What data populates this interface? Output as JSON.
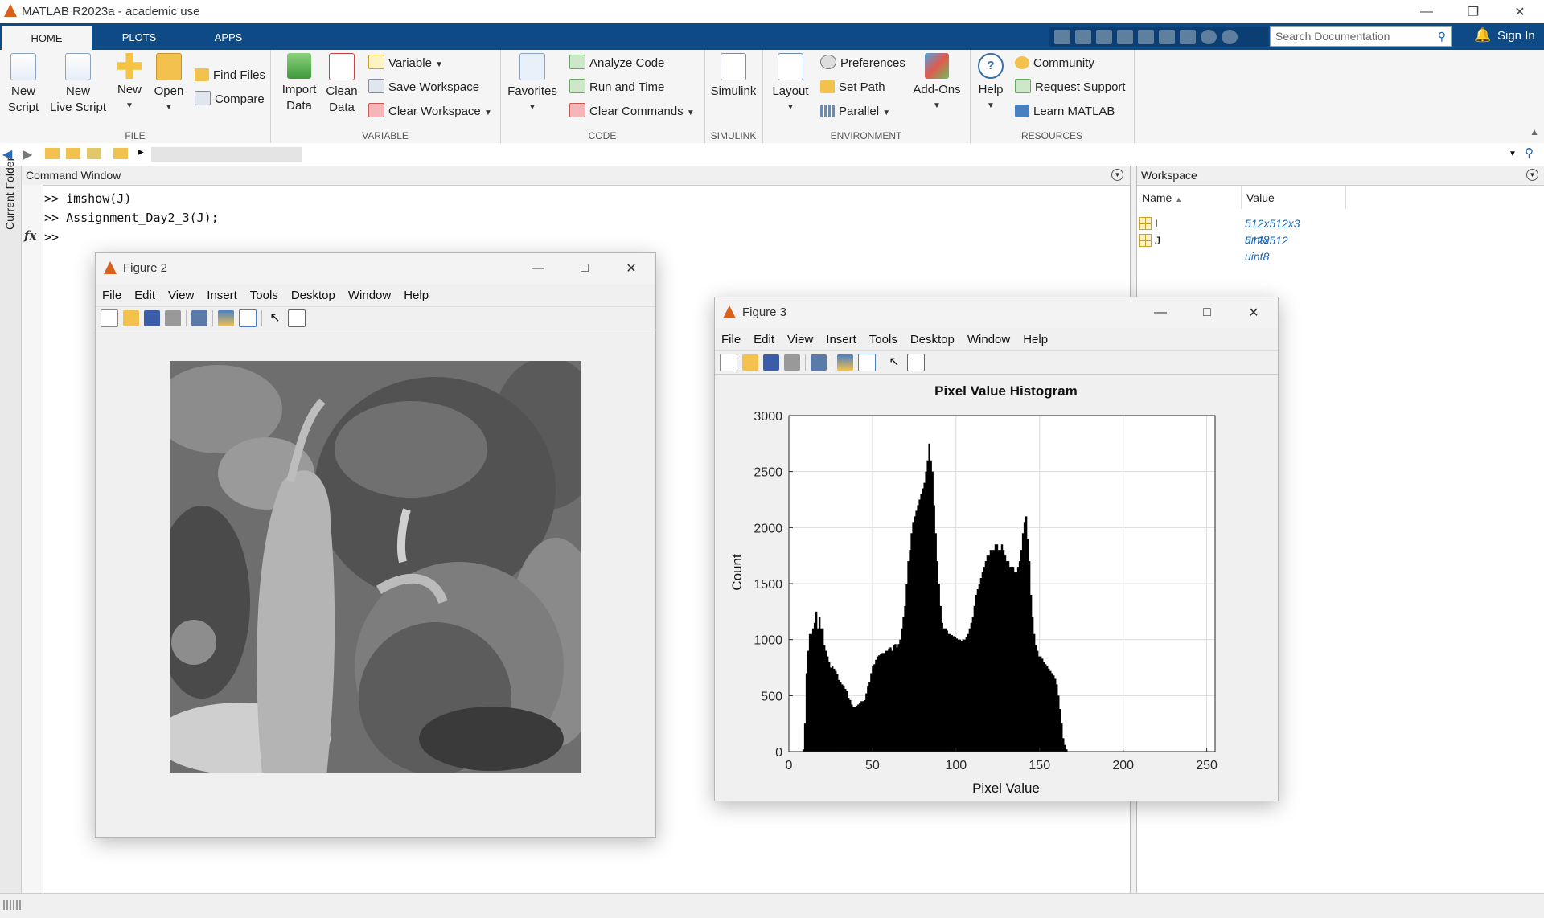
{
  "app": {
    "title": "MATLAB R2023a - academic use",
    "window_controls": [
      "minimize-icon",
      "restore-icon",
      "close-icon"
    ]
  },
  "ribbon": {
    "tabs": [
      {
        "label": "HOME",
        "active": true
      },
      {
        "label": "PLOTS",
        "active": false
      },
      {
        "label": "APPS",
        "active": false
      }
    ],
    "search_placeholder": "Search Documentation",
    "sign_in": "Sign In",
    "groups": {
      "file": {
        "label": "FILE",
        "new_script": [
          "New",
          "Script"
        ],
        "new_live_script": [
          "New",
          "Live Script"
        ],
        "new": "New",
        "open": "Open",
        "find_files": "Find Files",
        "compare": "Compare"
      },
      "variable": {
        "label": "VARIABLE",
        "import_data": [
          "Import",
          "Data"
        ],
        "clean_data": [
          "Clean",
          "Data"
        ],
        "variable": "Variable",
        "save_workspace": "Save Workspace",
        "clear_workspace": "Clear Workspace"
      },
      "code": {
        "label": "CODE",
        "favorites": "Favorites",
        "analyze_code": "Analyze Code",
        "run_and_time": "Run and Time",
        "clear_commands": "Clear Commands"
      },
      "simulink": {
        "label": "SIMULINK",
        "simulink": "Simulink"
      },
      "environment": {
        "label": "ENVIRONMENT",
        "layout": "Layout",
        "preferences": "Preferences",
        "set_path": "Set Path",
        "parallel": "Parallel",
        "add_ons": "Add-Ons"
      },
      "resources": {
        "label": "RESOURCES",
        "help": "Help",
        "community": "Community",
        "request_support": "Request Support",
        "learn_matlab": "Learn MATLAB"
      }
    }
  },
  "side_panel": {
    "current_folder": "Current Folder"
  },
  "command_window": {
    "title": "Command Window",
    "lines": [
      ">> imshow(J)",
      ">> Assignment_Day2_3(J);"
    ],
    "prompt": ">>",
    "fx": "fx"
  },
  "workspace": {
    "title": "Workspace",
    "columns": [
      "Name",
      "Value"
    ],
    "variables": [
      {
        "name": "I",
        "value": "512x512x3 uint8"
      },
      {
        "name": "J",
        "value": "512x512 uint8"
      }
    ]
  },
  "figure2": {
    "title": "Figure 2",
    "menu": [
      "File",
      "Edit",
      "View",
      "Insert",
      "Tools",
      "Desktop",
      "Window",
      "Help"
    ],
    "image": "grayscale peppers image"
  },
  "figure3": {
    "title": "Figure 3",
    "menu": [
      "File",
      "Edit",
      "View",
      "Insert",
      "Tools",
      "Desktop",
      "Window",
      "Help"
    ]
  },
  "chart_data": {
    "type": "bar",
    "title": "Pixel Value Histogram",
    "xlabel": "Pixel Value",
    "ylabel": "Count",
    "xlim": [
      0,
      255
    ],
    "ylim": [
      0,
      3000
    ],
    "xticks": [
      0,
      50,
      100,
      150,
      200,
      250
    ],
    "yticks": [
      0,
      500,
      1000,
      1500,
      2000,
      2500,
      3000
    ],
    "grid": true,
    "x_range": [
      0,
      255
    ],
    "values": [
      0,
      0,
      0,
      0,
      0,
      0,
      0,
      0,
      0,
      20,
      250,
      700,
      900,
      1050,
      1050,
      1100,
      1150,
      1250,
      1100,
      1200,
      1100,
      1100,
      950,
      900,
      850,
      800,
      750,
      760,
      740,
      720,
      690,
      640,
      620,
      600,
      580,
      560,
      540,
      480,
      460,
      420,
      400,
      400,
      410,
      420,
      430,
      450,
      450,
      460,
      520,
      580,
      620,
      700,
      760,
      780,
      820,
      850,
      860,
      870,
      880,
      880,
      900,
      900,
      920,
      930,
      900,
      950,
      960,
      930,
      960,
      1000,
      1100,
      1200,
      1300,
      1500,
      1700,
      1800,
      1950,
      2050,
      2100,
      2150,
      2200,
      2250,
      2300,
      2350,
      2400,
      2500,
      2600,
      2750,
      2600,
      2500,
      2200,
      1950,
      1700,
      1500,
      1300,
      1150,
      1100,
      1100,
      1080,
      1050,
      1050,
      1040,
      1030,
      1020,
      1010,
      1000,
      1000,
      990,
      1000,
      1000,
      1020,
      1050,
      1100,
      1150,
      1200,
      1300,
      1400,
      1450,
      1500,
      1550,
      1600,
      1650,
      1700,
      1750,
      1750,
      1800,
      1800,
      1800,
      1850,
      1850,
      1800,
      1800,
      1850,
      1800,
      1750,
      1700,
      1700,
      1650,
      1650,
      1650,
      1600,
      1600,
      1650,
      1700,
      1800,
      1950,
      2050,
      2100,
      1900,
      1700,
      1400,
      1200,
      1050,
      950,
      900,
      850,
      850,
      830,
      800,
      780,
      760,
      740,
      720,
      700,
      680,
      650,
      600,
      500,
      380,
      250,
      120,
      60,
      20,
      0,
      0,
      0,
      0,
      0,
      0,
      0,
      0,
      0,
      0,
      0,
      0,
      0,
      0,
      0,
      0,
      0,
      0,
      0,
      0,
      0,
      0,
      0,
      0,
      0,
      0,
      0,
      0,
      0,
      0,
      0,
      0,
      0,
      0,
      0,
      0,
      0,
      0,
      0,
      0,
      0,
      0,
      0,
      0,
      0,
      0,
      0,
      0,
      0,
      0,
      0,
      0,
      0,
      0,
      0,
      0,
      0,
      0,
      0,
      0,
      0,
      0,
      0,
      0,
      0,
      0,
      0,
      0,
      0,
      0,
      0,
      0,
      0,
      0,
      0,
      0,
      0,
      0,
      0,
      0,
      0,
      0,
      0,
      0,
      0,
      0,
      0,
      0,
      0,
      0,
      0,
      0
    ]
  },
  "colors": {
    "ribbon_blue": "#0e4a85",
    "workspace_value_blue": "#1b62ad",
    "matlab_orange": "#d9611c"
  }
}
